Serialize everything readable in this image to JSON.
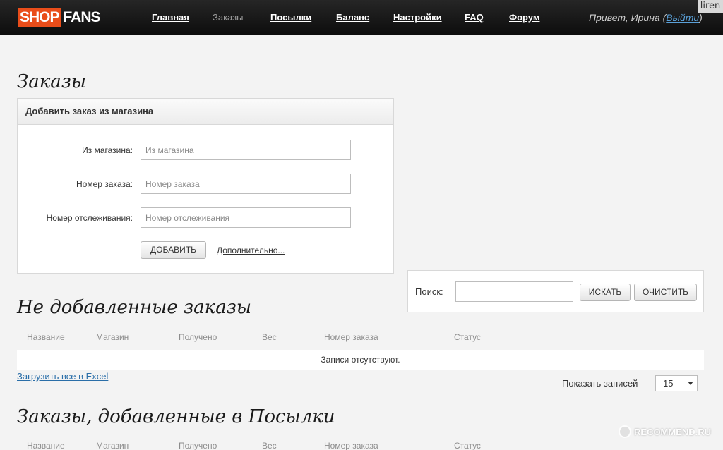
{
  "header": {
    "logo_shop": "SHOP",
    "logo_fans": "FANS",
    "nav": [
      {
        "label": "Главная",
        "active": false
      },
      {
        "label": "Заказы",
        "active": true
      },
      {
        "label": "Посылки",
        "active": false
      },
      {
        "label": "Баланс",
        "active": false
      },
      {
        "label": "Настройки",
        "active": false
      },
      {
        "label": "FAQ",
        "active": false
      },
      {
        "label": "Форум",
        "active": false
      }
    ],
    "greeting_prefix": "Привет, Ирина (",
    "logout_label": "Выйти",
    "greeting_suffix": ")",
    "user_tag": "liren"
  },
  "page": {
    "title": "Заказы"
  },
  "add_order": {
    "heading": "Добавить заказ из магазина",
    "fields": [
      {
        "label": "Из магазина:",
        "placeholder": "Из магазина"
      },
      {
        "label": "Номер заказа:",
        "placeholder": "Номер заказа"
      },
      {
        "label": "Номер отслеживания:",
        "placeholder": "Номер отслеживания"
      }
    ],
    "add_button": "ДОБАВИТЬ",
    "more_link": "Дополнительно..."
  },
  "search": {
    "label": "Поиск:",
    "value": "",
    "search_button": "ИСКАТЬ",
    "clear_button": "ОЧИСТИТЬ"
  },
  "not_added": {
    "title": "Не добавленные заказы",
    "columns": [
      "Название",
      "Магазин",
      "Получено",
      "Вес",
      "Номер заказа",
      "Статус"
    ],
    "empty_text": "Записи отсутствуют.",
    "excel_link": "Загрузить все в Excel",
    "show_label": "Показать записей",
    "page_size": "15"
  },
  "in_parcels": {
    "title": "Заказы, добавленные в Посылки",
    "columns": [
      "Название",
      "Магазин",
      "Получено",
      "Вес",
      "Номер заказа",
      "Статус"
    ]
  },
  "watermark": "RECOMMEND.RU",
  "colors": {
    "topbar": "#151515",
    "logo_accent": "#e94d1a",
    "link": "#2a6ea8",
    "background": "#f3f3f3"
  }
}
